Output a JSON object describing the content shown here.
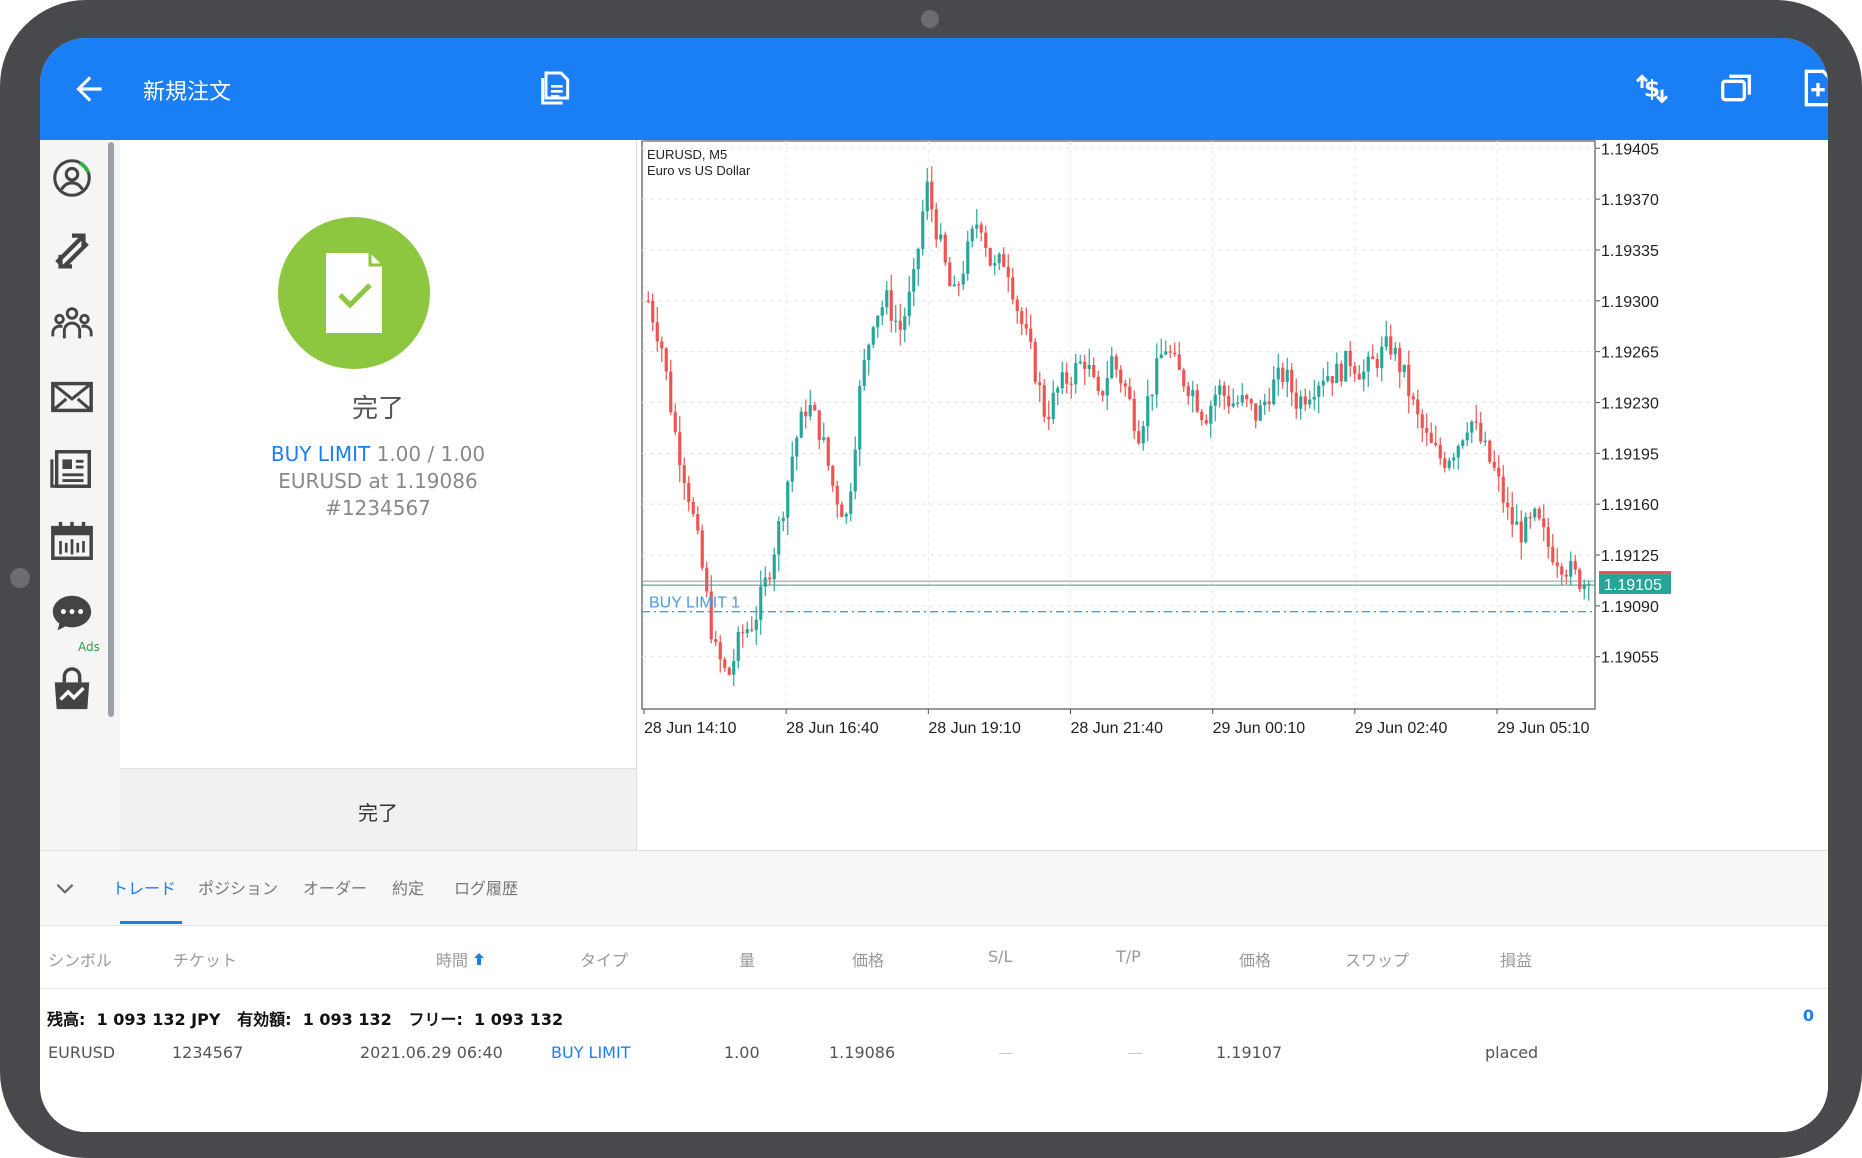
{
  "header": {
    "title": "新規注文",
    "back_icon": "arrow-left-icon",
    "icons": [
      "documents-icon",
      "currency-exchange-icon",
      "window-restore-icon",
      "new-document-icon"
    ],
    "bar_color": "#1a7ef5"
  },
  "sidebar": {
    "items": [
      {
        "icon": "account-icon"
      },
      {
        "icon": "trade-arrows-icon"
      },
      {
        "icon": "community-icon"
      },
      {
        "icon": "mail-icon"
      },
      {
        "icon": "news-icon"
      },
      {
        "icon": "calendar-icon",
        "badge": "Ads"
      },
      {
        "icon": "chat-icon"
      },
      {
        "icon": "market-bag-icon"
      }
    ]
  },
  "result": {
    "status_icon": "document-check-icon",
    "status_color": "#8dc63f",
    "title": "完了",
    "order_type": "BUY LIMIT",
    "volume": "1.00 / 1.00",
    "symbol_line": "EURUSD at 1.19086",
    "ticket": "#1234567",
    "done_button": "完了"
  },
  "chart": {
    "symbol_label": "EURUSD, M5",
    "description": "Euro vs US Dollar",
    "order_line_label": "BUY LIMIT 1",
    "current_price": "1.19105",
    "bull_color": "#26a69a",
    "bear_color": "#ef5350"
  },
  "chart_data": {
    "type": "candlestick",
    "title": "EURUSD, M5",
    "subtitle": "Euro vs US Dollar",
    "x_tick_labels": [
      "28 Jun 14:10",
      "28 Jun 16:40",
      "28 Jun 19:10",
      "28 Jun 21:40",
      "29 Jun 00:10",
      "29 Jun 02:40",
      "29 Jun 05:10"
    ],
    "y_tick_labels": [
      "1.19405",
      "1.19370",
      "1.19335",
      "1.19300",
      "1.19265",
      "1.19230",
      "1.19195",
      "1.19160",
      "1.19125",
      "1.19090",
      "1.19055"
    ],
    "ylim": [
      1.19019,
      1.1941
    ],
    "current_price": 1.19105,
    "order_price": 1.19086,
    "close_series": [
      1.193,
      1.1927,
      1.1921,
      1.1917,
      1.1912,
      1.1906,
      1.1904,
      1.1907,
      1.1908,
      1.1911,
      1.1915,
      1.192,
      1.1923,
      1.1921,
      1.1917,
      1.1915,
      1.1924,
      1.1929,
      1.193,
      1.1928,
      1.1931,
      1.1938,
      1.1934,
      1.193,
      1.1933,
      1.1936,
      1.1932,
      1.1933,
      1.1929,
      1.1926,
      1.1922,
      1.1924,
      1.1925,
      1.1926,
      1.1923,
      1.1926,
      1.1924,
      1.1921,
      1.1924,
      1.1927,
      1.1925,
      1.1924,
      1.1922,
      1.1924,
      1.1923,
      1.1923,
      1.1922,
      1.1924,
      1.1925,
      1.1923,
      1.1924,
      1.1925,
      1.1925,
      1.1926,
      1.1925,
      1.1926,
      1.1927,
      1.1925,
      1.1922,
      1.192,
      1.1919,
      1.192,
      1.1922,
      1.192,
      1.1918,
      1.1915,
      1.1914,
      1.1915,
      1.1913,
      1.1912,
      1.1911,
      1.19105
    ],
    "grid": true
  },
  "bottom": {
    "collapse_icon": "chevron-down-icon",
    "tabs": [
      "トレード",
      "ポジション",
      "オーダー",
      "約定",
      "ログ履歴"
    ],
    "columns": [
      "シンボル",
      "チケット",
      "時間",
      "タイプ",
      "量",
      "価格",
      "S/L",
      "T/P",
      "価格",
      "スワップ",
      "損益"
    ],
    "sort_icon": "sort-up-icon",
    "balance": "残高:  1 093 132 JPY   有効額:  1 093 132   フリー:  1 093 132",
    "balance_value": "0",
    "rows": [
      {
        "symbol": "EURUSD",
        "ticket": "1234567",
        "time": "2021.06.29 06:40",
        "type": "BUY LIMIT",
        "volume": "1.00",
        "price": "1.19086",
        "sl": "—",
        "tp": "—",
        "cur_price": "1.19107",
        "swap": "",
        "pl": "placed"
      }
    ]
  }
}
